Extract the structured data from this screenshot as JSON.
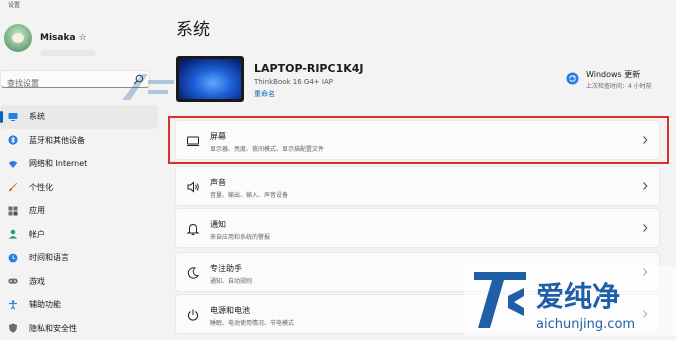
{
  "window": {
    "app_title": "设置"
  },
  "profile": {
    "name": "Misaka ☆"
  },
  "search": {
    "placeholder": "查找设置"
  },
  "sidebar": {
    "items": [
      {
        "label": "系统",
        "icon": "monitor-icon"
      },
      {
        "label": "蓝牙和其他设备",
        "icon": "bluetooth-icon"
      },
      {
        "label": "网络和 Internet",
        "icon": "wifi-icon"
      },
      {
        "label": "个性化",
        "icon": "brush-icon"
      },
      {
        "label": "应用",
        "icon": "apps-icon"
      },
      {
        "label": "帐户",
        "icon": "person-icon"
      },
      {
        "label": "时间和语言",
        "icon": "globe-clock-icon"
      },
      {
        "label": "游戏",
        "icon": "gamepad-icon"
      },
      {
        "label": "辅助功能",
        "icon": "accessibility-icon"
      },
      {
        "label": "隐私和安全性",
        "icon": "shield-icon"
      }
    ]
  },
  "main": {
    "title": "系统",
    "device": {
      "name": "LAPTOP-RIPC1K4J",
      "model": "ThinkBook 16 G4+ IAP",
      "rename": "重命名"
    },
    "update": {
      "title": "Windows 更新",
      "subtitle": "上次检查时间：4 小时前"
    },
    "cards": [
      {
        "title": "屏幕",
        "subtitle": "显示器、亮度、夜间模式、显示描配置文件",
        "icon": "display-icon"
      },
      {
        "title": "声音",
        "subtitle": "音量、输出、输入、声音设备",
        "icon": "speaker-icon"
      },
      {
        "title": "通知",
        "subtitle": "来自应用和系统的警报",
        "icon": "bell-icon"
      },
      {
        "title": "专注助手",
        "subtitle": "通知、自动规则",
        "icon": "moon-icon"
      },
      {
        "title": "电源和电池",
        "subtitle": "睡眠、电池使用情况、节电模式",
        "icon": "power-icon"
      }
    ]
  },
  "watermark": {
    "brand": "爱纯净",
    "url": "aichunjing.com"
  },
  "colors": {
    "accent": "#0067c0",
    "highlight": "#d9322c",
    "watermark": "#1f5fa8"
  }
}
